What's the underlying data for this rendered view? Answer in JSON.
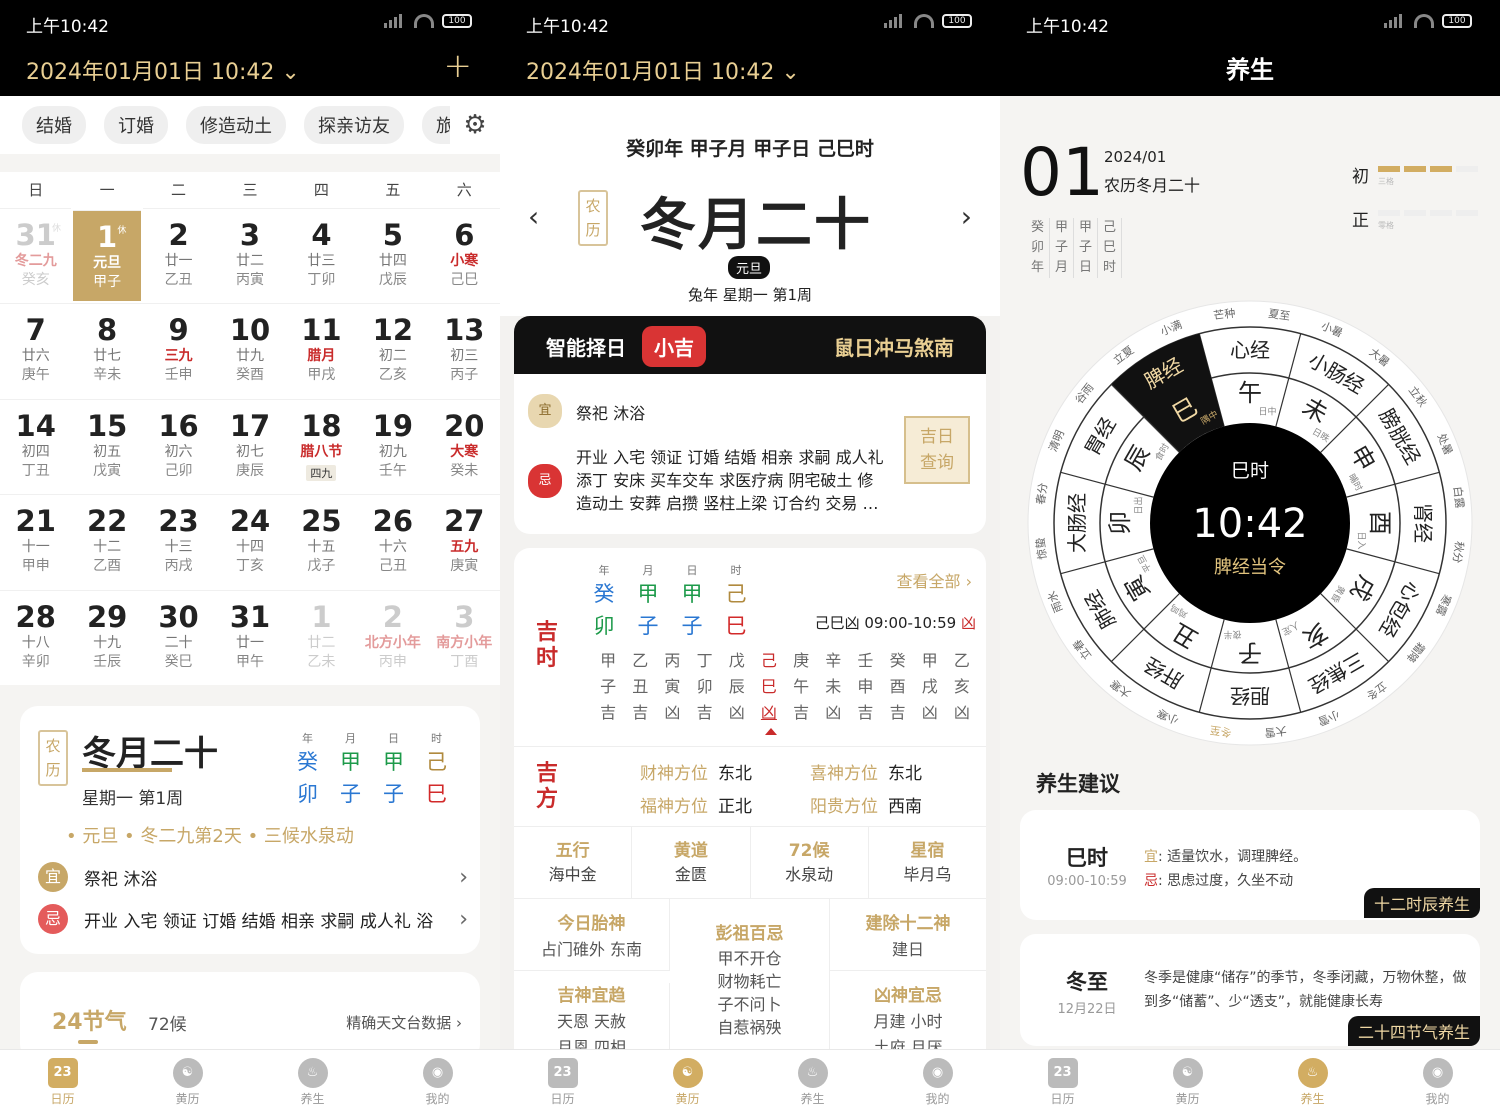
{
  "status": {
    "time": "上午10:42",
    "battery": "100"
  },
  "p1": {
    "date": "2024年01月01日 10:42",
    "plus": "+",
    "chips": [
      "结婚",
      "订婚",
      "修造动土",
      "探亲访友",
      "旅"
    ],
    "weekdays": [
      "日",
      "一",
      "二",
      "三",
      "四",
      "五",
      "六"
    ],
    "days": [
      {
        "d": "31",
        "l": "冬二九",
        "g": "癸亥",
        "dim": true,
        "sup": "休",
        "lc": "pink"
      },
      {
        "d": "1",
        "l": "元旦",
        "g": "甲子",
        "today": true,
        "sup": "休"
      },
      {
        "d": "2",
        "l": "廿一",
        "g": "乙丑"
      },
      {
        "d": "3",
        "l": "廿二",
        "g": "丙寅"
      },
      {
        "d": "4",
        "l": "廿三",
        "g": "丁卯"
      },
      {
        "d": "5",
        "l": "廿四",
        "g": "戊辰"
      },
      {
        "d": "6",
        "l": "小寒",
        "g": "己巳",
        "lc": "red"
      },
      {
        "d": "7",
        "l": "廿六",
        "g": "庚午"
      },
      {
        "d": "8",
        "l": "廿七",
        "g": "辛未"
      },
      {
        "d": "9",
        "l": "三九",
        "g": "壬申",
        "lc": "red"
      },
      {
        "d": "10",
        "l": "廿九",
        "g": "癸酉"
      },
      {
        "d": "11",
        "l": "腊月",
        "g": "甲戌",
        "lc": "red"
      },
      {
        "d": "12",
        "l": "初二",
        "g": "乙亥"
      },
      {
        "d": "13",
        "l": "初三",
        "g": "丙子"
      },
      {
        "d": "14",
        "l": "初四",
        "g": "丁丑"
      },
      {
        "d": "15",
        "l": "初五",
        "g": "戊寅"
      },
      {
        "d": "16",
        "l": "初六",
        "g": "己卯"
      },
      {
        "d": "17",
        "l": "初七",
        "g": "庚辰"
      },
      {
        "d": "18",
        "l": "腊八节",
        "g": "四九",
        "lc": "red",
        "tag": true
      },
      {
        "d": "19",
        "l": "初九",
        "g": "壬午"
      },
      {
        "d": "20",
        "l": "大寒",
        "g": "癸未",
        "lc": "red"
      },
      {
        "d": "21",
        "l": "十一",
        "g": "甲申"
      },
      {
        "d": "22",
        "l": "十二",
        "g": "乙酉"
      },
      {
        "d": "23",
        "l": "十三",
        "g": "丙戌"
      },
      {
        "d": "24",
        "l": "十四",
        "g": "丁亥"
      },
      {
        "d": "25",
        "l": "十五",
        "g": "戊子"
      },
      {
        "d": "26",
        "l": "十六",
        "g": "己丑"
      },
      {
        "d": "27",
        "l": "五九",
        "g": "庚寅",
        "lc": "red"
      },
      {
        "d": "28",
        "l": "十八",
        "g": "辛卯"
      },
      {
        "d": "29",
        "l": "十九",
        "g": "壬辰"
      },
      {
        "d": "30",
        "l": "二十",
        "g": "癸巳"
      },
      {
        "d": "31",
        "l": "廿一",
        "g": "甲午"
      },
      {
        "d": "1",
        "l": "廿二",
        "g": "乙未",
        "dim": true
      },
      {
        "d": "2",
        "l": "北方小年",
        "g": "丙申",
        "dim": true,
        "lc": "pink"
      },
      {
        "d": "3",
        "l": "南方小年",
        "g": "丁酉",
        "dim": true,
        "lc": "pink"
      }
    ],
    "seal": "农历",
    "lunar": "冬月二十",
    "week": "星期一 第1周",
    "gz_heads": [
      "年",
      "月",
      "日",
      "时"
    ],
    "gz_top": [
      "癸",
      "甲",
      "甲",
      "己"
    ],
    "gz_bot": [
      "卯",
      "子",
      "子",
      "巳"
    ],
    "events": "• 元旦 • 冬二九第2天 • 三候水泉动",
    "yi_label": "宜",
    "yi": "祭祀 沐浴",
    "ji_label": "忌",
    "ji": "开业 入宅 领证 订婚 结婚 相亲 求嗣 成人礼 浴",
    "jq_title": "24节气",
    "jq_sub": "72候",
    "jq_link": "精确天文台数据 ›"
  },
  "p2": {
    "date": "2024年01月01日 10:42",
    "ganzhi": "癸卯年  甲子月  甲子日  己巳时",
    "seal": "农历",
    "lunar": "冬月二十",
    "holiday": "元旦",
    "sub": "兔年  星期一  第1周",
    "smart": "智能择日",
    "luck": "小吉",
    "clash": "鼠日冲马煞南",
    "yi_label": "宜",
    "yi": "祭祀 沐浴",
    "ji_label": "忌",
    "ji": "开业 入宅 领证 订婚 结婚 相亲 求嗣 成人礼 添丁 安床 买车交车 求医疗病 阴宅破土 修 造动土 安葬 启攒 竖柱上梁 订合约 交易 …",
    "stamp": "吉日 查询",
    "jishi_title": "吉时",
    "gz_heads": [
      "年",
      "月",
      "日",
      "时"
    ],
    "gz_top": [
      "癸",
      "甲",
      "甲",
      "己"
    ],
    "gz_bot": [
      "卯",
      "子",
      "子",
      "巳"
    ],
    "see_all": "查看全部 ›",
    "cur_hour": "己巳凶 09:00-10:59",
    "cur_mark": "凶",
    "hours_top": [
      "甲",
      "乙",
      "丙",
      "丁",
      "戊",
      "己",
      "庚",
      "辛",
      "壬",
      "癸",
      "甲",
      "乙"
    ],
    "hours_mid": [
      "子",
      "丑",
      "寅",
      "卯",
      "辰",
      "巳",
      "午",
      "未",
      "申",
      "酉",
      "戌",
      "亥"
    ],
    "hours_bot": [
      "吉",
      "吉",
      "凶",
      "吉",
      "凶",
      "凶",
      "吉",
      "凶",
      "吉",
      "吉",
      "凶",
      "凶"
    ],
    "jifang_title": "吉方",
    "dirs": [
      {
        "k": "财神方位",
        "v": "东北"
      },
      {
        "k": "喜神方位",
        "v": "东北"
      },
      {
        "k": "福神方位",
        "v": "正北"
      },
      {
        "k": "阳贵方位",
        "v": "西南"
      }
    ],
    "info": [
      {
        "k": "五行",
        "v": "海中金"
      },
      {
        "k": "黄道",
        "v": "金匮"
      },
      {
        "k": "72候",
        "v": "水泉动"
      },
      {
        "k": "星宿",
        "v": "毕月乌"
      }
    ],
    "taishen_k": "今日胎神",
    "taishen_v": "占门碓外 东南",
    "pengzu_k": "彭祖百忌",
    "pengzu_v": [
      "甲不开仓",
      "财物耗亡",
      "子不问卜",
      "自惹祸殃"
    ],
    "jianchu_k": "建除十二神",
    "jianchu_v": "建日",
    "jishen_k": "吉神宜趋",
    "jishen_v": "天恩  天赦",
    "jishen_v2": "月恩  四相",
    "xiongshen_k": "凶神宜忌",
    "xiongshen_v": "月建  小时",
    "xiongshen_v2": "土府  月厌"
  },
  "p3": {
    "title": "养生",
    "day": "01",
    "ym": "2024/01",
    "lunar": "农历冬月二十",
    "gz_cols": [
      [
        "癸",
        "卯",
        "年"
      ],
      [
        "甲",
        "子",
        "月"
      ],
      [
        "甲",
        "子",
        "日"
      ],
      [
        "己",
        "巳",
        "时"
      ]
    ],
    "chu": "初",
    "chu_sub": "三格",
    "chu_level": 3,
    "zheng": "正",
    "zheng_sub": "零格",
    "zheng_level": 0,
    "hour": "巳时",
    "clock": "10:42",
    "meridian_now": "脾经当令",
    "wheel_meridians": [
      "心经",
      "小肠经",
      "膀胱经",
      "肾经",
      "心包经",
      "三焦经",
      "胆经",
      "肝经",
      "肺经",
      "大肠经",
      "胃经",
      "脾经"
    ],
    "wheel_branches": [
      "午",
      "未",
      "申",
      "酉",
      "戌",
      "亥",
      "子",
      "丑",
      "寅",
      "卯",
      "辰",
      "巳"
    ],
    "wheel_times": [
      "日中",
      "日昳",
      "晡时",
      "日入",
      "黄昏",
      "人定",
      "夜半",
      "鸡鸣",
      "平旦",
      "日出",
      "食时",
      "隅中"
    ],
    "terms": [
      "夏至",
      "小暑",
      "大暑",
      "立秋",
      "处暑",
      "白露",
      "秋分",
      "寒露",
      "霜降",
      "立冬",
      "小雪",
      "大雪",
      "冬至",
      "小寒",
      "大寒",
      "立春",
      "雨水",
      "惊蛰",
      "春分",
      "清明",
      "谷雨",
      "立夏",
      "小满",
      "芒种"
    ],
    "advice_title": "养生建议",
    "card1_k": "巳时",
    "card1_t": "09:00-10:59",
    "card1_yi_label": "宜",
    "card1_yi": ": 适量饮水，调理脾经。",
    "card1_ji_label": "忌",
    "card1_ji": ": 思虑过度，久坐不动",
    "card1_badge": "十二时辰养生",
    "card2_k": "冬至",
    "card2_t": "12月22日",
    "card2_text": "冬季是健康“储存”的季节，冬季闭藏，万物休整，做到多“储蓄”、少“透支”，就能健康长寿",
    "card2_badge": "二十四节气养生"
  },
  "tabs": [
    {
      "label": "日历",
      "icon": "23"
    },
    {
      "label": "黄历",
      "icon": "☯"
    },
    {
      "label": "养生",
      "icon": "♨"
    },
    {
      "label": "我的",
      "icon": "◉"
    }
  ],
  "colors": {
    "gold": "#c7a767",
    "red": "#c92b2b",
    "black": "#000000"
  }
}
